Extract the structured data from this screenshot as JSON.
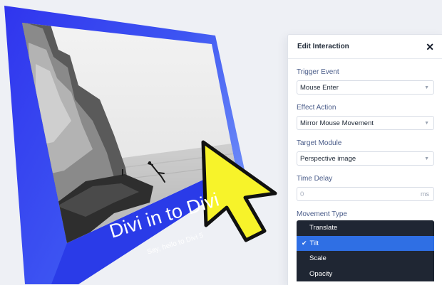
{
  "card": {
    "title": "Divi in to Divi",
    "subtitle": "Say, hello to Divi 5",
    "frame_color": "#2f3cf0",
    "photo_description_icon": "cliff-diver-photo"
  },
  "cursor": {
    "icon": "arrow-cursor-icon",
    "fill": "#f7f32a"
  },
  "panel": {
    "title": "Edit Interaction",
    "close_glyph": "✕",
    "trigger_event": {
      "label": "Trigger Event",
      "value": "Mouse Enter"
    },
    "effect_action": {
      "label": "Effect Action",
      "value": "Mirror Mouse Movement"
    },
    "target_module": {
      "label": "Target Module",
      "value": "Perspective image"
    },
    "time_delay": {
      "label": "Time Delay",
      "value": "0",
      "unit": "ms"
    },
    "movement_type": {
      "label": "Movement Type",
      "options": [
        "Translate",
        "Tilt",
        "Scale",
        "Opacity"
      ],
      "selected": "Tilt"
    },
    "accent": "#2f6fe4"
  }
}
